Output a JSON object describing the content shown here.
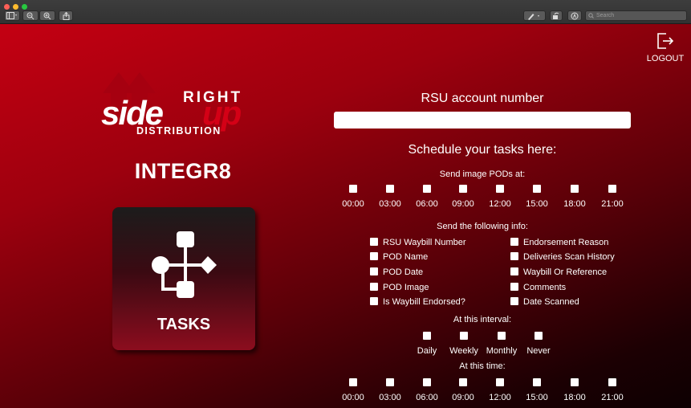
{
  "toolbar": {
    "search_placeholder": "Search"
  },
  "header": {
    "logout_label": "LOGOUT"
  },
  "logo": {
    "word_right": "RIGHT",
    "word_side": "side",
    "word_up": "up",
    "word_distribution": "DISTRIBUTION"
  },
  "app": {
    "title": "INTEGR8",
    "tasks_label": "TASKS"
  },
  "form": {
    "account_label": "RSU account number",
    "account_value": "",
    "schedule_heading": "Schedule your tasks here:",
    "pods_heading": "Send image PODs at:",
    "pod_times": [
      "00:00",
      "03:00",
      "06:00",
      "09:00",
      "12:00",
      "15:00",
      "18:00",
      "21:00"
    ],
    "info_heading": "Send the following info:",
    "info_left": [
      "RSU Waybill Number",
      "POD Name",
      "POD Date",
      "POD Image",
      "Is Waybill Endorsed?"
    ],
    "info_right": [
      "Endorsement Reason",
      "Deliveries Scan History",
      "Waybill Or Reference",
      "Comments",
      "Date Scanned"
    ],
    "interval_heading": "At this interval:",
    "intervals": [
      "Daily",
      "Weekly",
      "Monthly",
      "Never"
    ],
    "time_heading": "At this time:",
    "times": [
      "00:00",
      "03:00",
      "06:00",
      "09:00",
      "12:00",
      "15:00",
      "18:00",
      "21:00"
    ]
  },
  "colors": {
    "accent_red": "#c40012",
    "dark": "#0d0002",
    "tile_bottom": "#8c0d1e"
  }
}
